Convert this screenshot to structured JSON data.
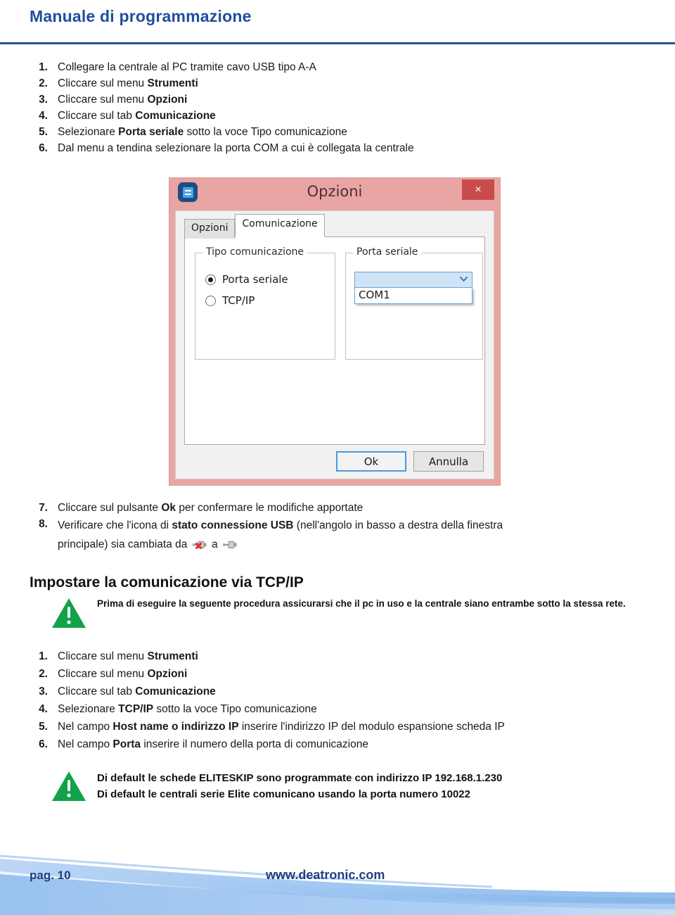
{
  "header": {
    "title": "Manuale di programmazione"
  },
  "steps_usb": [
    {
      "num": "1.",
      "html": "Collegare la centrale al PC tramite cavo USB tipo A-A"
    },
    {
      "num": "2.",
      "html": "Cliccare sul menu <b>Strumenti</b>"
    },
    {
      "num": "3.",
      "html": "Cliccare sul menu <b>Opzioni</b>"
    },
    {
      "num": "4.",
      "html": "Cliccare sul tab <b>Comunicazione</b>"
    },
    {
      "num": "5.",
      "html": "Selezionare <b>Porta seriale</b> sotto la voce Tipo comunicazione"
    },
    {
      "num": "6.",
      "html": "Dal menu a tendina selezionare la porta COM a cui è collegata la centrale"
    }
  ],
  "dialog": {
    "app_icon": "app-e-icon",
    "title": "Opzioni",
    "close_label": "×",
    "tabs": [
      {
        "label": "Opzioni",
        "active": false
      },
      {
        "label": "Comunicazione",
        "active": true
      }
    ],
    "group_tipo": {
      "legend": "Tipo comunicazione",
      "options": [
        {
          "label": "Porta seriale",
          "selected": true
        },
        {
          "label": "TCP/IP",
          "selected": false
        }
      ]
    },
    "group_porta": {
      "legend": "Porta seriale",
      "combo_value": "",
      "dropdown_open": true,
      "options": [
        "COM1"
      ]
    },
    "buttons": {
      "ok": "Ok",
      "cancel": "Annulla"
    },
    "colors": {
      "titlebar": "#e9a4a4",
      "close_button": "#c94c4c",
      "combo_fill": "#cfe4f6",
      "combo_border": "#6aa3d5"
    }
  },
  "steps_usb_cont": [
    {
      "num": "7.",
      "html": "Cliccare sul pulsante <b>Ok</b> per confermare le modifiche apportate"
    }
  ],
  "step8": {
    "num": "8.",
    "line1": "Verificare che l'icona di <b>stato connessione USB</b> (nell'angolo in basso a destra della finestra",
    "line2_pre": "principale) sia cambiata da",
    "line2_mid": "a",
    "icon_from": "usb-disconnected-icon",
    "icon_to": "usb-connected-icon"
  },
  "tcpip_section": {
    "heading": "Impostare la comunicazione via TCP/IP",
    "warning": "Prima di eseguire la seguente procedura assicurarsi che il pc in uso e la centrale siano  entrambe sotto la stessa rete.",
    "steps": [
      {
        "num": "1.",
        "html": "Cliccare sul menu <b>Strumenti</b>"
      },
      {
        "num": "2.",
        "html": "Cliccare sul menu <b>Opzioni</b>"
      },
      {
        "num": "3.",
        "html": "Cliccare sul tab <b>Comunicazione</b>"
      },
      {
        "num": "4.",
        "html": "Selezionare <b>TCP/IP</b> sotto la voce Tipo comunicazione"
      },
      {
        "num": "5.",
        "html": "Nel campo <b>Host name o indirizzo IP</b> inserire l'indirizzo IP del modulo espansione scheda IP"
      },
      {
        "num": "6.",
        "html": "Nel campo <b>Porta</b> inserire il numero della porta di comunicazione"
      }
    ],
    "default_note_line1": "Di default le schede ELITESKIP sono programmate con indirizzo IP 192.168.1.230",
    "default_note_line2": "Di default le centrali serie Elite comunicano usando la porta numero 10022"
  },
  "footer": {
    "page_label": "pag. 10",
    "url": "www.deatronic.com",
    "wave_color": "#7fb2ea",
    "brand_color": "#1f3f80"
  }
}
